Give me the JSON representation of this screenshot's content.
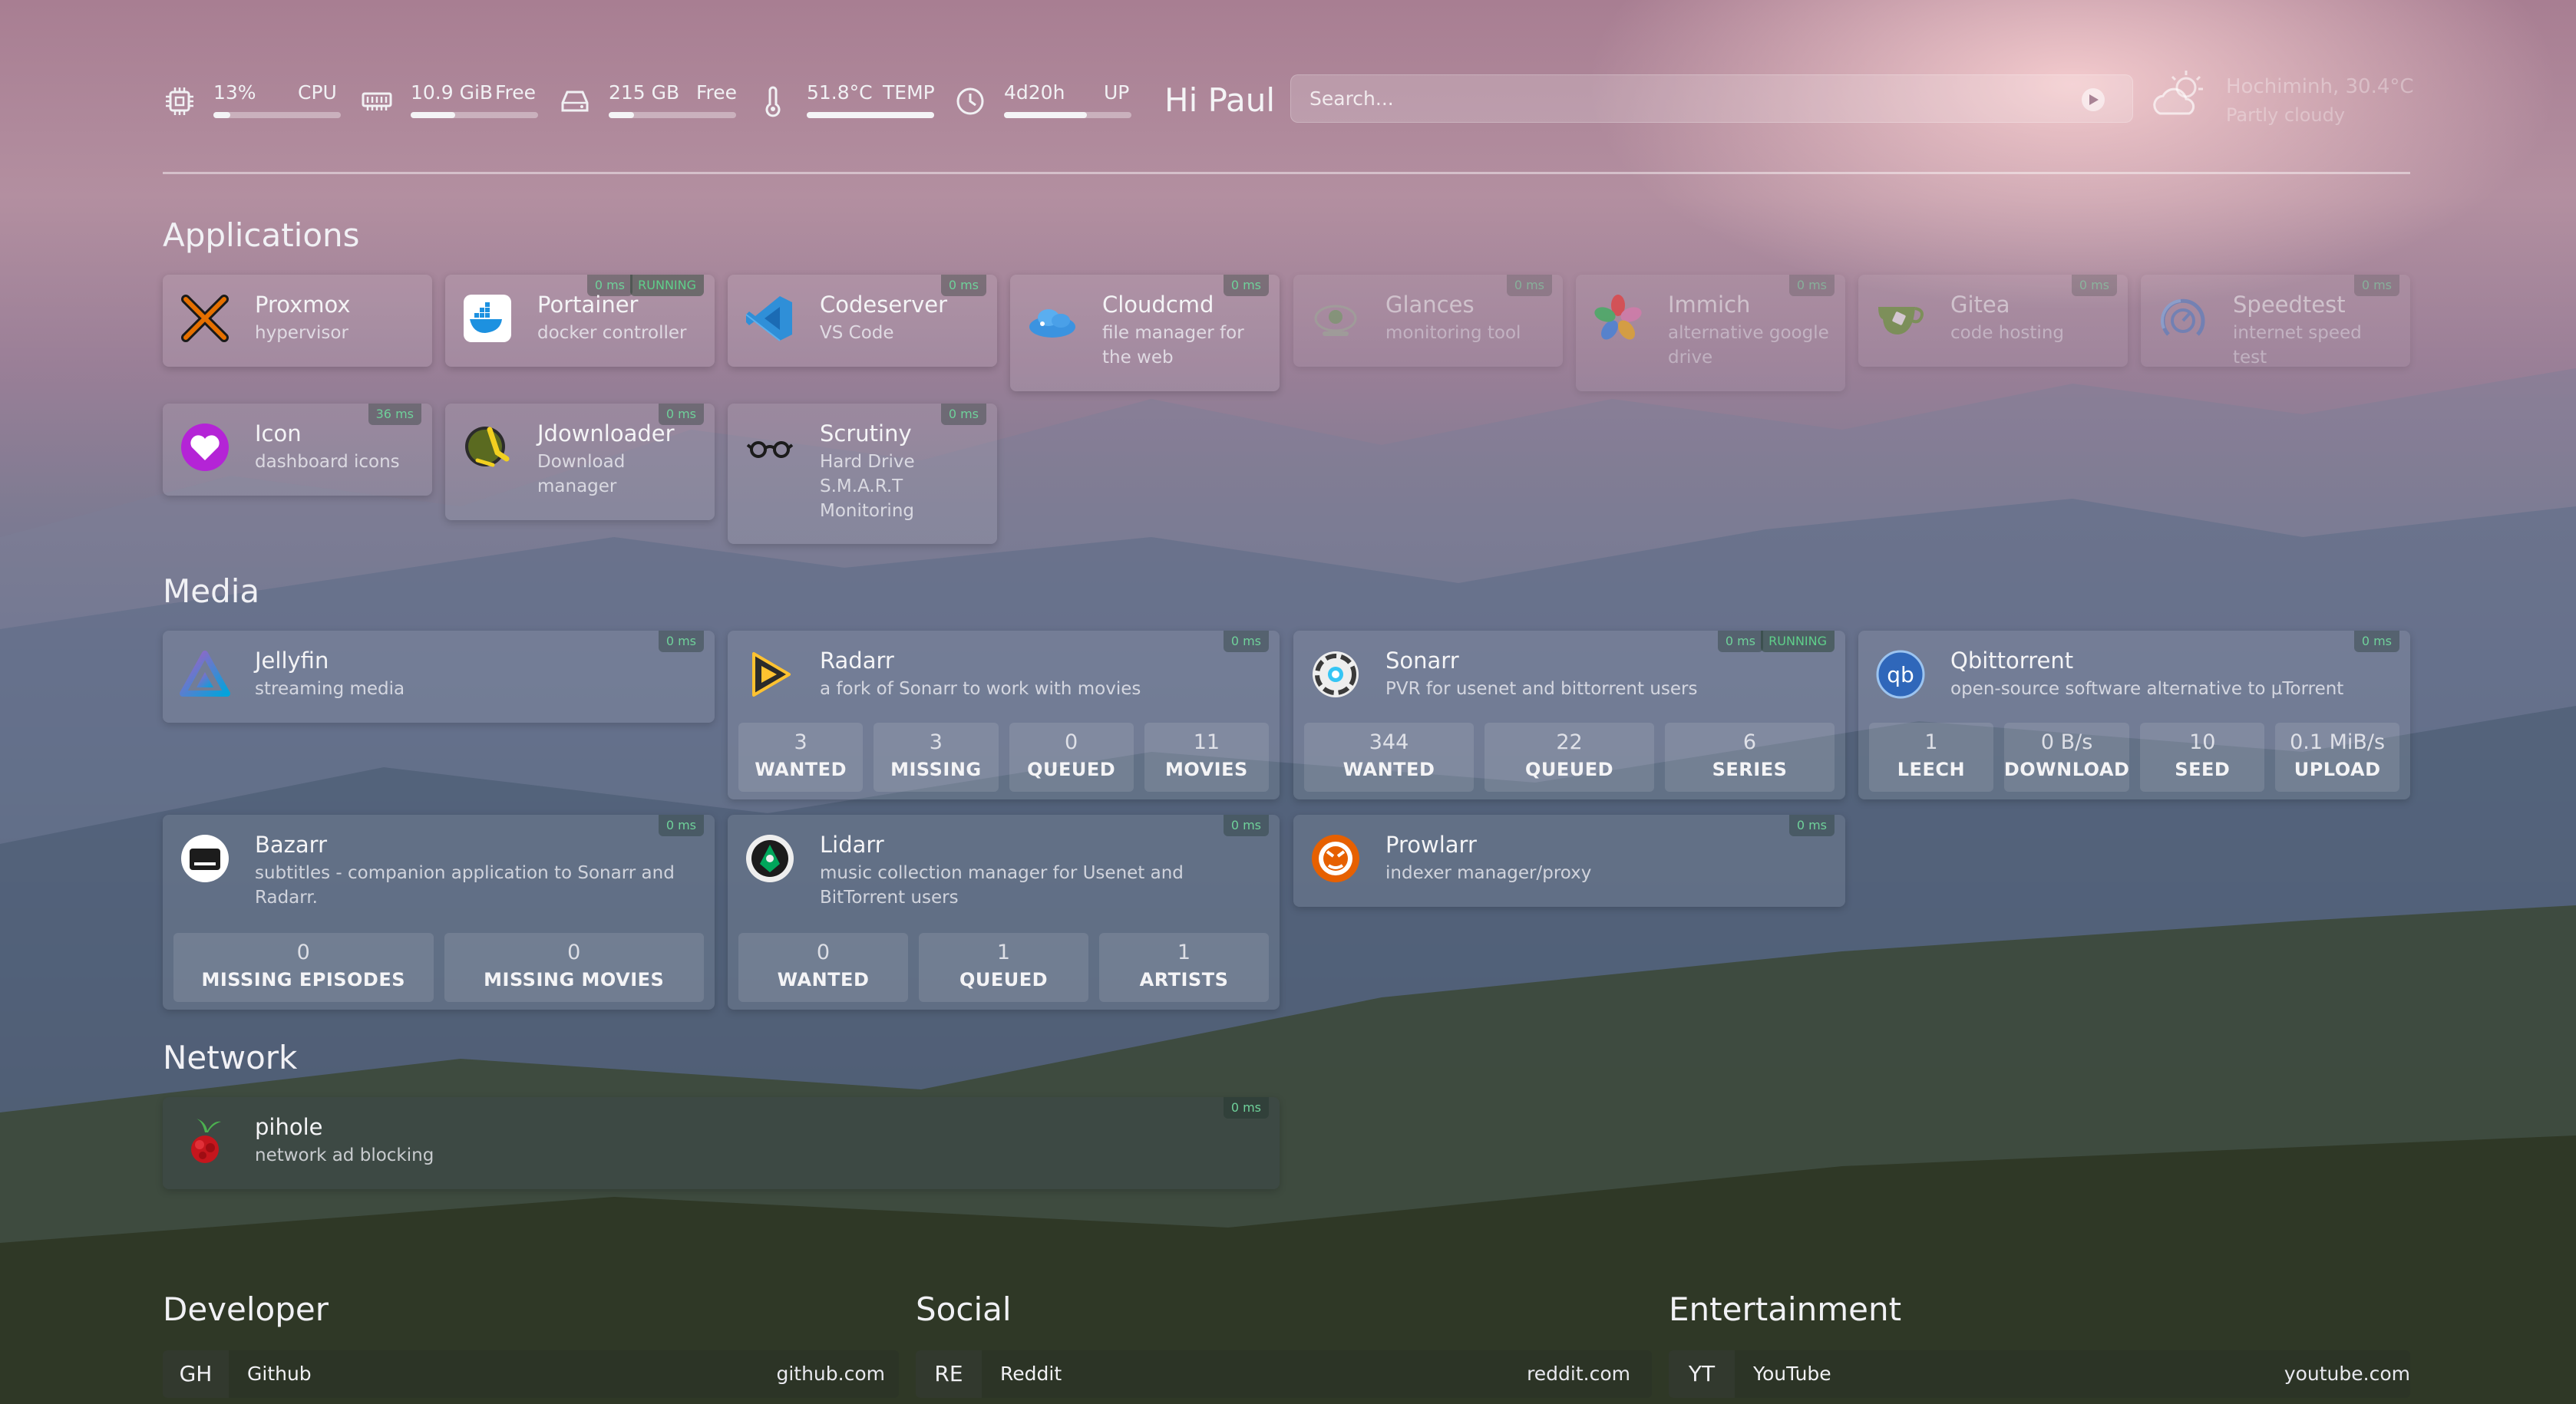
{
  "stats": {
    "cpu": {
      "value": "13%",
      "label": "CPU",
      "percent": 13
    },
    "ram": {
      "value": "10.9 GiB",
      "label": "Free",
      "percent": 35
    },
    "disk": {
      "value": "215 GB",
      "label": "Free",
      "percent": 20
    },
    "temp": {
      "value": "51.8°C",
      "label": "TEMP",
      "percent": 100
    },
    "uptime": {
      "value": "4d20h",
      "label": "UP",
      "percent": 65
    }
  },
  "greeting": "Hi Paul",
  "search": {
    "placeholder": "Search..."
  },
  "weather": {
    "location": "Hochiminh, 30.4°C",
    "condition": "Partly cloudy",
    "icon": "partly-cloudy-icon"
  },
  "sections": {
    "applications": "Applications",
    "media": "Media",
    "network": "Network"
  },
  "applications": [
    {
      "name": "Proxmox",
      "desc": "hypervisor",
      "icon": "proxmox-icon"
    },
    {
      "name": "Portainer",
      "desc": "docker controller",
      "ping": "0 ms",
      "status": "RUNNING",
      "icon": "portainer-icon"
    },
    {
      "name": "Codeserver",
      "desc": "VS Code",
      "ping": "0 ms",
      "icon": "vscode-icon"
    },
    {
      "name": "Cloudcmd",
      "desc": "file manager for the web",
      "ping": "0 ms",
      "icon": "cloudcmd-icon"
    },
    {
      "name": "Glances",
      "desc": "monitoring tool",
      "ping": "0 ms",
      "icon": "glances-icon"
    },
    {
      "name": "Immich",
      "desc": "alternative google drive",
      "ping": "0 ms",
      "icon": "immich-icon"
    },
    {
      "name": "Gitea",
      "desc": "code hosting",
      "ping": "0 ms",
      "icon": "gitea-icon"
    },
    {
      "name": "Speedtest",
      "desc": "internet speed test",
      "ping": "0 ms",
      "icon": "speedtest-icon"
    },
    {
      "name": "Icon",
      "desc": "dashboard icons",
      "ping": "36 ms",
      "icon": "heart-icon"
    },
    {
      "name": "Jdownloader",
      "desc": "Download manager",
      "ping": "0 ms",
      "icon": "jdownloader-icon"
    },
    {
      "name": "Scrutiny",
      "desc": "Hard Drive S.M.A.R.T Monitoring",
      "ping": "0 ms",
      "icon": "glasses-icon"
    }
  ],
  "media": {
    "jellyfin": {
      "name": "Jellyfin",
      "desc": "streaming media",
      "ping": "0 ms"
    },
    "radarr": {
      "name": "Radarr",
      "desc": "a fork of Sonarr to work with movies",
      "ping": "0 ms",
      "widgets": [
        {
          "value": "3",
          "label": "WANTED"
        },
        {
          "value": "3",
          "label": "MISSING"
        },
        {
          "value": "0",
          "label": "QUEUED"
        },
        {
          "value": "11",
          "label": "MOVIES"
        }
      ]
    },
    "sonarr": {
      "name": "Sonarr",
      "desc": "PVR for usenet and bittorrent users",
      "ping": "0 ms",
      "status": "RUNNING",
      "widgets": [
        {
          "value": "344",
          "label": "WANTED"
        },
        {
          "value": "22",
          "label": "QUEUED"
        },
        {
          "value": "6",
          "label": "SERIES"
        }
      ]
    },
    "qbittorrent": {
      "name": "Qbittorrent",
      "desc": "open-source software alternative to µTorrent",
      "ping": "0 ms",
      "widgets": [
        {
          "value": "1",
          "label": "LEECH"
        },
        {
          "value": "0 B/s",
          "label": "DOWNLOAD"
        },
        {
          "value": "10",
          "label": "SEED"
        },
        {
          "value": "0.1 MiB/s",
          "label": "UPLOAD"
        }
      ]
    },
    "bazarr": {
      "name": "Bazarr",
      "desc": "subtitles - companion application to Sonarr and Radarr.",
      "ping": "0 ms",
      "widgets": [
        {
          "value": "0",
          "label": "MISSING EPISODES"
        },
        {
          "value": "0",
          "label": "MISSING MOVIES"
        }
      ]
    },
    "lidarr": {
      "name": "Lidarr",
      "desc": "music collection manager for Usenet and BitTorrent users",
      "ping": "0 ms",
      "widgets": [
        {
          "value": "0",
          "label": "WANTED"
        },
        {
          "value": "1",
          "label": "QUEUED"
        },
        {
          "value": "1",
          "label": "ARTISTS"
        }
      ]
    },
    "prowlarr": {
      "name": "Prowlarr",
      "desc": "indexer manager/proxy",
      "ping": "0 ms"
    }
  },
  "network": {
    "pihole": {
      "name": "pihole",
      "desc": "network ad blocking",
      "ping": "0 ms"
    }
  },
  "bookmarks": {
    "developer": {
      "title": "Developer",
      "items": [
        {
          "abbr": "GH",
          "name": "Github",
          "url": "github.com"
        }
      ]
    },
    "social": {
      "title": "Social",
      "items": [
        {
          "abbr": "RE",
          "name": "Reddit",
          "url": "reddit.com"
        }
      ]
    },
    "entertainment": {
      "title": "Entertainment",
      "items": [
        {
          "abbr": "YT",
          "name": "YouTube",
          "url": "youtube.com"
        }
      ]
    }
  },
  "colors": {
    "ping": "#6fd19a",
    "accent": "#e8e8ee"
  }
}
